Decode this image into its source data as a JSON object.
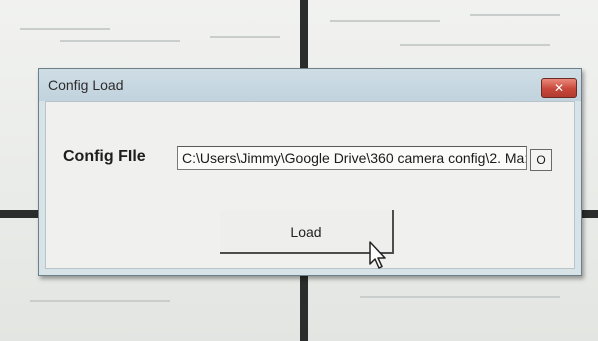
{
  "dialog": {
    "title": "Config Load",
    "close_symbol": "✕"
  },
  "config_file": {
    "label": "Config FIle",
    "value": "C:\\Users\\Jimmy\\Google Drive\\360 camera config\\2. Ma:",
    "browse_label": "O"
  },
  "load_button": {
    "label": "Load"
  },
  "icons": {
    "close": "close-icon",
    "cursor": "mouse-pointer-icon"
  },
  "colors": {
    "titlebar": "#c1d3de",
    "close_button": "#c7473a",
    "client_background": "#f0f1ee"
  }
}
